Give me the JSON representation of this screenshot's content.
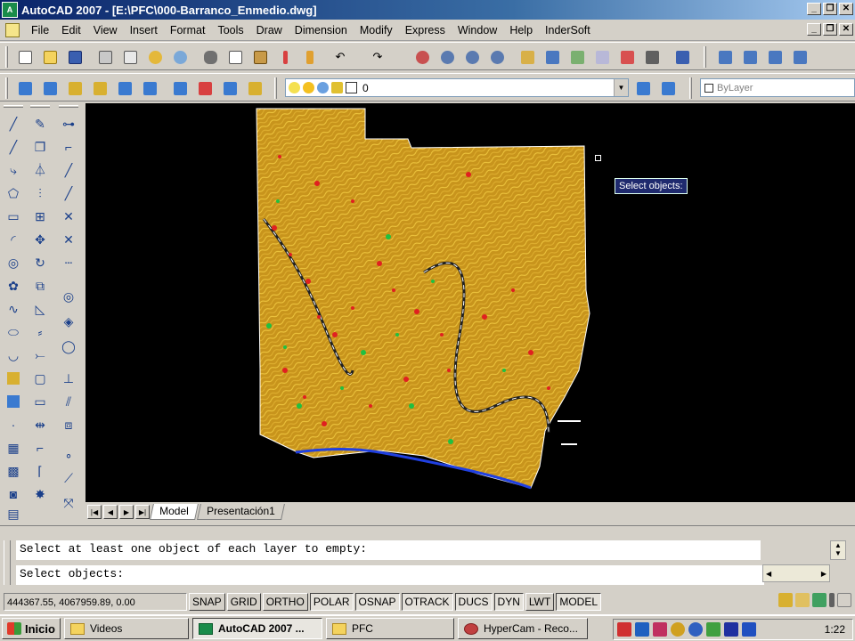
{
  "window": {
    "title": "AutoCAD 2007 - [E:\\PFC\\000-Barranco_Enmedio.dwg]",
    "app_icon_text": "A"
  },
  "menu": {
    "items": [
      "File",
      "Edit",
      "View",
      "Insert",
      "Format",
      "Tools",
      "Draw",
      "Dimension",
      "Modify",
      "Express",
      "Window",
      "Help",
      "InderSoft"
    ]
  },
  "layer": {
    "current": "0",
    "color_combo": "ByLayer"
  },
  "canvas": {
    "tooltip": "Select objects:",
    "background": "#000000",
    "terrain_color": "#d4a31c"
  },
  "layout_tabs": {
    "model": "Model",
    "layout1": "Presentación1"
  },
  "command": {
    "line1": "Select at least one object of each layer to empty:",
    "line2": "Select objects:"
  },
  "status": {
    "coordinates": "444367.55, 4067959.89, 0.00",
    "toggles": [
      {
        "label": "SNAP",
        "on": false
      },
      {
        "label": "GRID",
        "on": false
      },
      {
        "label": "ORTHO",
        "on": false
      },
      {
        "label": "POLAR",
        "on": true
      },
      {
        "label": "OSNAP",
        "on": true
      },
      {
        "label": "OTRACK",
        "on": true
      },
      {
        "label": "DUCS",
        "on": true
      },
      {
        "label": "DYN",
        "on": true
      },
      {
        "label": "LWT",
        "on": false
      },
      {
        "label": "MODEL",
        "on": true
      }
    ]
  },
  "taskbar": {
    "start": "Inicio",
    "tasks": [
      "Videos",
      "AutoCAD 2007 ...",
      "PFC",
      "HyperCam - Reco..."
    ],
    "clock": "1:22"
  }
}
